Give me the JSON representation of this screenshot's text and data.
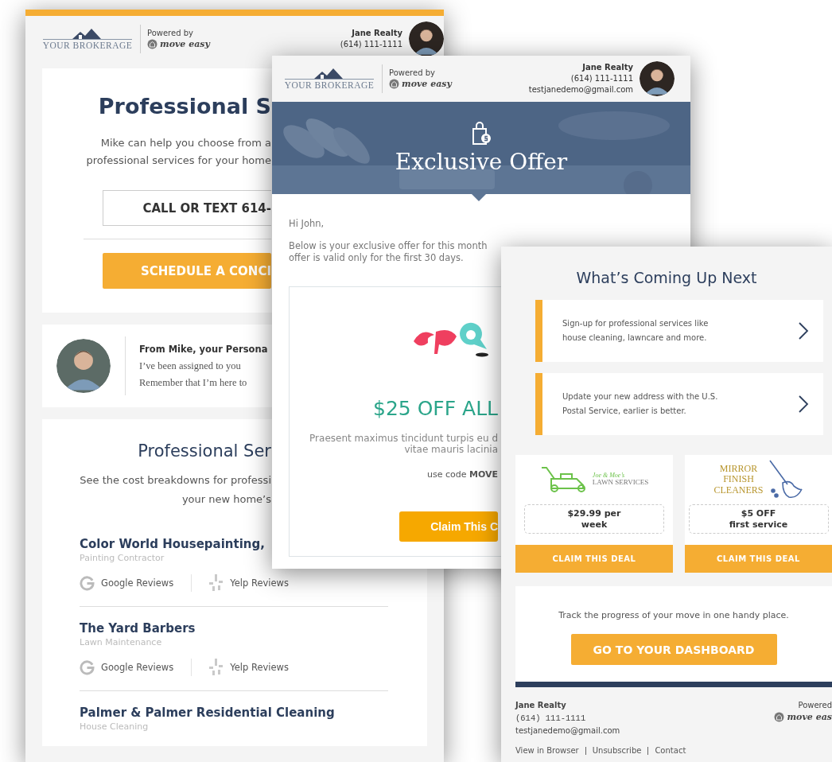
{
  "services_email": {
    "brokerage": "YOUR BROKERAGE",
    "powered_by": "Powered by",
    "moveeasy": "move easy",
    "agent": [
      "Jane Realty",
      "(614) 111-1111"
    ],
    "title": "Professional S",
    "intro": [
      "Mike can help you choose from a",
      "professional services for your home"
    ],
    "call_button": "CALL OR TEXT 614-",
    "schedule_button": "SCHEDULE A CONCI",
    "note": {
      "heading": "From Mike, your Persona",
      "lines": [
        "I’ve been assigned to you",
        "Remember that I’m here to"
      ]
    },
    "section_title": "Professional Ser",
    "section_intro": [
      "See the cost breakdowns for professi",
      "your new home’s"
    ],
    "providers": [
      {
        "name": "Color World Housepainting,",
        "category": "Painting Contractor",
        "reviews": [
          {
            "kind": "google",
            "label": "Google Reviews"
          },
          {
            "kind": "yelp",
            "label": "Yelp Reviews"
          }
        ]
      },
      {
        "name": "The Yard Barbers",
        "category": "Lawn Maintenance",
        "reviews": [
          {
            "kind": "google",
            "label": "Google Reviews"
          },
          {
            "kind": "yelp",
            "label": "Yelp Reviews"
          }
        ]
      },
      {
        "name": "Palmer & Palmer Residential Cleaning",
        "category": "House Cleaning"
      }
    ]
  },
  "offer_email": {
    "brokerage": "YOUR BROKERAGE",
    "powered_by": "Powered by",
    "moveeasy": "move easy",
    "agent": [
      "Jane Realty",
      "(614) 111-1111",
      "testjanedemo@gmail.com"
    ],
    "banner_title": "Exclusive Offer",
    "greeting": "Hi John,",
    "body": [
      "Below is your exclusive offer for this month",
      "offer is valid only for the first 30 days."
    ],
    "offer": {
      "headline": "$25 OFF ALL",
      "description": [
        "Praesent maximus tincidunt turpis eu d",
        "vitae mauris lacinia"
      ],
      "code": "use code **MOVE**",
      "button": "Claim This C"
    }
  },
  "next_email": {
    "title": "What’s Coming Up Next",
    "steps": [
      {
        "lines": [
          "Sign-up for professional services like",
          "house cleaning, lawncare and more."
        ]
      },
      {
        "lines": [
          "Update your new address with the U.S.",
          "Postal Service, earlier is better."
        ]
      }
    ],
    "deals": [
      {
        "kind": "lawn",
        "logo": [
          "Joe & Moe’s",
          "LAWN SERVICES"
        ],
        "price": [
          "$29.99 per",
          "week"
        ],
        "button": "CLAIM THIS DEAL"
      },
      {
        "kind": "cleaners",
        "logo": [
          "MIRROR",
          "FINISH",
          "CLEANERS"
        ],
        "price": [
          "$5 OFF",
          "first service"
        ],
        "button": "CLAIM THIS DEAL"
      }
    ],
    "dashboard": {
      "text": "Track the progress of your move in one handy place.",
      "button": "GO TO YOUR DASHBOARD"
    },
    "footer": {
      "name": "Jane Realty",
      "phone": "(614) 111-1111",
      "email": "testjanedemo@gmail.com",
      "powered": "Powered",
      "moveeasy": "move eas",
      "links": [
        "View in Browser",
        "Unsubscribe",
        "Contact"
      ]
    }
  }
}
